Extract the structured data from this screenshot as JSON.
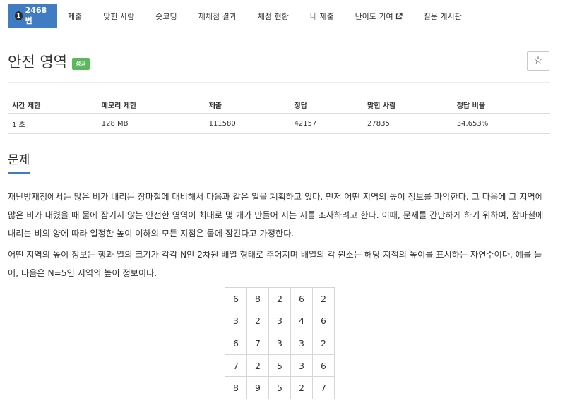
{
  "nav": {
    "active": {
      "level": "1",
      "label": "2468번"
    },
    "items": [
      {
        "name": "submit",
        "label": "제출"
      },
      {
        "name": "solvers",
        "label": "맞힌 사람"
      },
      {
        "name": "shortest",
        "label": "숏코딩"
      },
      {
        "name": "rejudge-result",
        "label": "재채점 결과"
      },
      {
        "name": "grading-status",
        "label": "채점 현황"
      },
      {
        "name": "my-submissions",
        "label": "내 제출"
      },
      {
        "name": "difficulty",
        "label": "난이도 기여",
        "icon": "external-link-icon"
      },
      {
        "name": "board",
        "label": "질문 게시판"
      }
    ]
  },
  "title": {
    "text": "안전 영역",
    "badge": "성공",
    "badge_color": "#5cb85c",
    "star": "☆"
  },
  "info": {
    "headers": [
      "시간 제한",
      "메모리 제한",
      "제출",
      "정답",
      "맞힌 사람",
      "정답 비율"
    ],
    "values": [
      "1 초",
      "128 MB",
      "111580",
      "42157",
      "27835",
      "34.653%"
    ]
  },
  "problem": {
    "heading": "문제",
    "paragraph1": "재난방재청에서는 많은 비가 내리는 장마철에 대비해서 다음과 같은 일을 계획하고 있다. 먼저 어떤 지역의 높이 정보를 파악한다. 그 다음에 그 지역에 많은 비가 내렸을 때 물에 잠기지 않는 안전한 영역이 최대로 몇 개가 만들어 지는 지를 조사하려고 한다. 이때, 문제를 간단하게 하기 위하여, 장마철에 내리는 비의 양에 따라 일정한 높이 이하의 모든 지점은 물에 잠긴다고 가정한다.",
    "paragraph2": "어떤 지역의 높이 정보는 행과 열의 크기가 각각 N인 2차원 배열 형태로 주어지며 배열의 각 원소는 해당 지점의 높이를 표시하는 자연수이다. 예를 들어, 다음은 N=5인 지역의 높이 정보이다.",
    "grid": [
      [
        "6",
        "8",
        "2",
        "6",
        "2"
      ],
      [
        "3",
        "2",
        "3",
        "4",
        "6"
      ],
      [
        "6",
        "7",
        "3",
        "3",
        "2"
      ],
      [
        "7",
        "2",
        "5",
        "3",
        "6"
      ],
      [
        "8",
        "9",
        "5",
        "2",
        "7"
      ]
    ]
  },
  "colors": {
    "accent": "#3f7cc3",
    "success": "#5cb85c"
  }
}
